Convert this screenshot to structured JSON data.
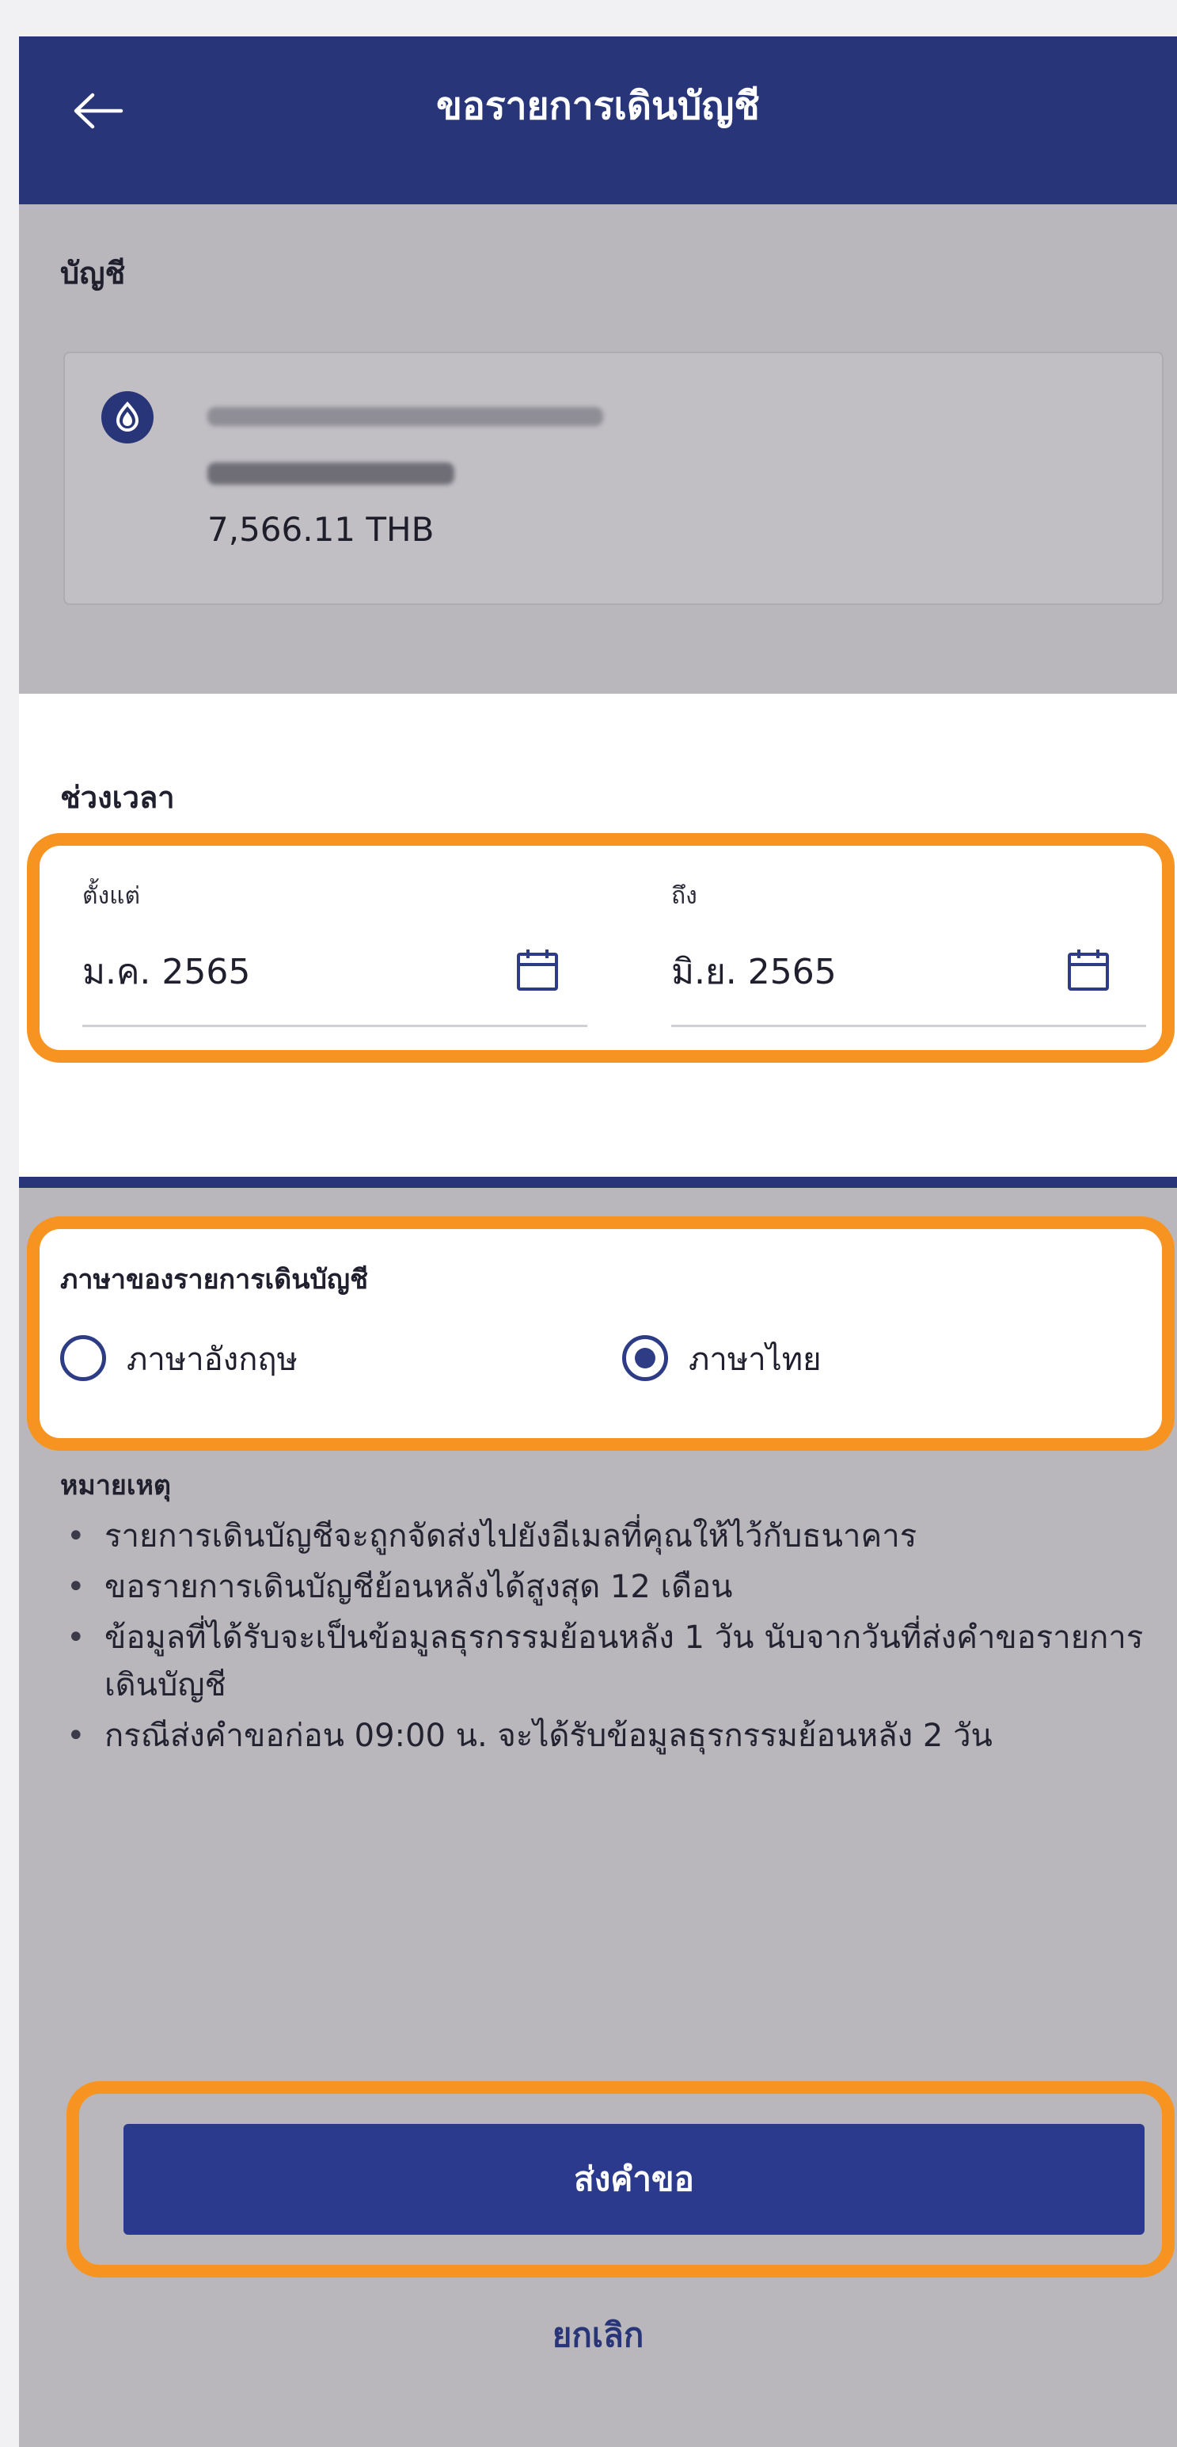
{
  "header": {
    "title": "ขอรายการเดินบัญชี",
    "back_icon": "arrow-left-icon"
  },
  "account": {
    "section_label": "บัญชี",
    "logo_icon": "bank-logo-icon",
    "balance": "7,566.11 THB",
    "name_hidden": true,
    "number_hidden": true
  },
  "period": {
    "section_label": "ช่วงเวลา",
    "from_label": "ตั้งแต่",
    "from_value": "ม.ค. 2565",
    "to_label": "ถึง",
    "to_value": "มิ.ย. 2565",
    "calendar_icon": "calendar-icon"
  },
  "language": {
    "title": "ภาษาของรายการเดินบัญชี",
    "options": [
      {
        "label": "ภาษาอังกฤษ",
        "selected": false
      },
      {
        "label": "ภาษาไทย",
        "selected": true
      }
    ]
  },
  "notes": {
    "title": "หมายเหตุ",
    "items": [
      "รายการเดินบัญชีจะถูกจัดส่งไปยังอีเมลที่คุณให้ไว้กับธนาคาร",
      "ขอรายการเดินบัญชีย้อนหลังได้สูงสุด 12 เดือน",
      "ข้อมูลที่ได้รับจะเป็นข้อมูลธุรกรรมย้อนหลัง 1 วัน นับจากวันที่ส่งคำขอรายการเดินบัญชี",
      "กรณีส่งคำขอก่อน 09:00 น. จะได้รับข้อมูลธุรกรรมย้อนหลัง 2 วัน"
    ]
  },
  "actions": {
    "submit_label": "ส่งคำขอ",
    "cancel_label": "ยกเลิก"
  },
  "colors": {
    "brand_navy": "#283578",
    "highlight_orange": "#f79421",
    "overlay_gray": "#b9b7bb"
  }
}
